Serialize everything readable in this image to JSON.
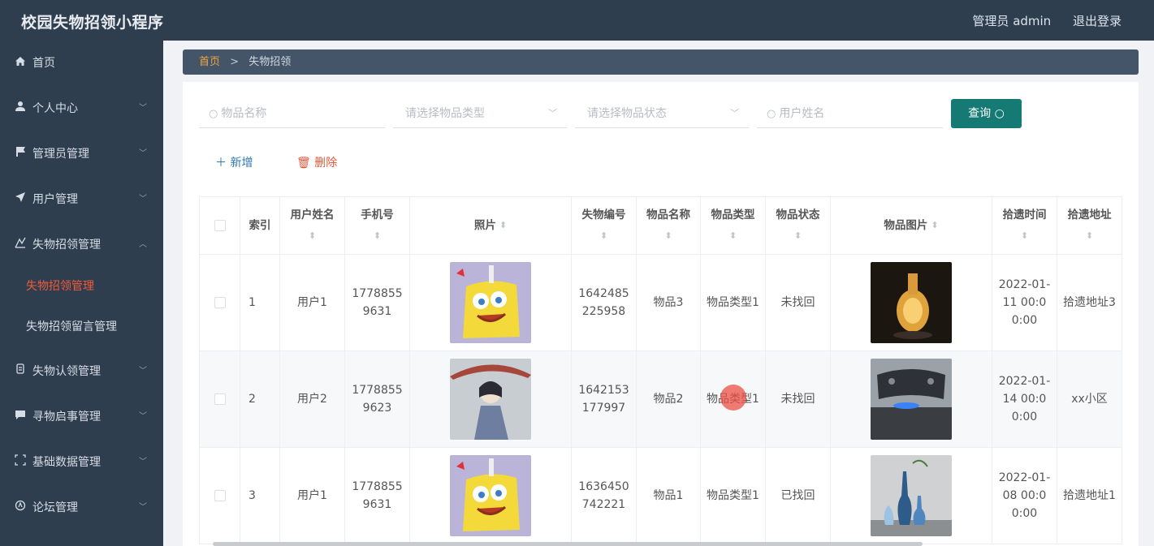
{
  "app": {
    "title": "校园失物招领小程序",
    "user_label": "管理员 admin",
    "logout_label": "退出登录"
  },
  "sidebar": {
    "items": [
      {
        "label": "首页",
        "icon": "home-icon"
      },
      {
        "label": "个人中心",
        "icon": "user-icon"
      },
      {
        "label": "管理员管理",
        "icon": "flag-icon"
      },
      {
        "label": "用户管理",
        "icon": "send-icon"
      },
      {
        "label": "失物招领管理",
        "icon": "lost-icon"
      },
      {
        "label": "失物认领管理",
        "icon": "claim-icon"
      },
      {
        "label": "寻物启事管理",
        "icon": "message-icon"
      },
      {
        "label": "基础数据管理",
        "icon": "data-icon"
      },
      {
        "label": "论坛管理",
        "icon": "forum-icon"
      }
    ],
    "sub_items": [
      {
        "label": "失物招领管理",
        "active": true
      },
      {
        "label": "失物招领留言管理",
        "active": false
      }
    ]
  },
  "breadcrumb": {
    "home": "首页",
    "sep": ">",
    "current": "失物招领"
  },
  "search": {
    "name_placeholder": "物品名称",
    "type_placeholder": "请选择物品类型",
    "status_placeholder": "请选择物品状态",
    "user_placeholder": "用户姓名",
    "query_label": "查询"
  },
  "actions": {
    "add_label": "新增",
    "delete_label": "删除"
  },
  "table": {
    "headers": [
      "索引",
      "用户姓名",
      "手机号",
      "照片",
      "失物编号",
      "物品名称",
      "物品类型",
      "物品状态",
      "物品图片",
      "拾遗时间",
      "拾遗地址"
    ],
    "rows": [
      {
        "index": "1",
        "user": "用户1",
        "phone": "17788559631",
        "code": "1642485225958",
        "name": "物品3",
        "type": "物品类型1",
        "status": "未找回",
        "time": "2022-01-11 00:00:00",
        "address": "拾遗地址3"
      },
      {
        "index": "2",
        "user": "用户2",
        "phone": "17788559623",
        "code": "1642153177997",
        "name": "物品2",
        "type": "物品类型1",
        "status": "未找回",
        "time": "2022-01-14 00:00:00",
        "address": "xx小区"
      },
      {
        "index": "3",
        "user": "用户1",
        "phone": "17788559631",
        "code": "1636450742221",
        "name": "物品1",
        "type": "物品类型1",
        "status": "已找回",
        "time": "2022-01-08 00:00:00",
        "address": "拾遗地址1"
      }
    ]
  },
  "colors": {
    "sidebar_bg": "#2f3e4f",
    "active": "#f05a3a",
    "query_btn": "#147a73",
    "breadcrumb_home": "#f0a440"
  }
}
